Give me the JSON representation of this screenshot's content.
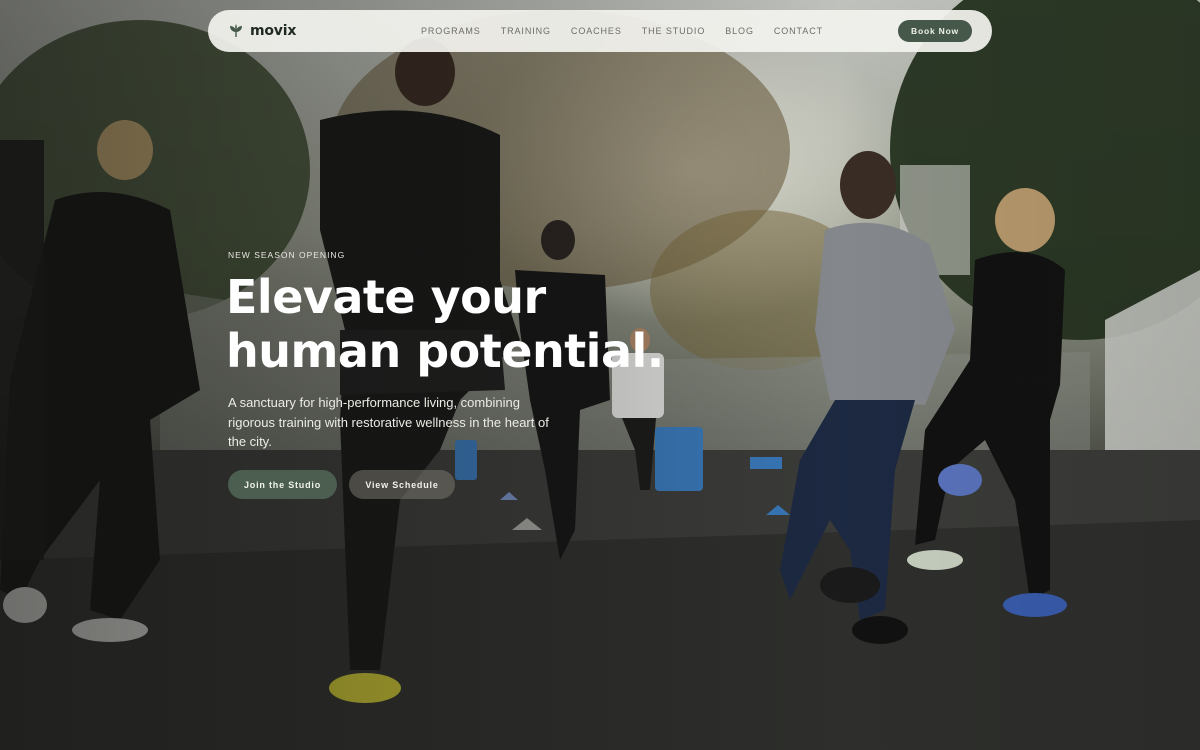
{
  "brand": {
    "name": "movix",
    "icon": "leaf-icon",
    "accent": "#46584a"
  },
  "nav": {
    "links": [
      "PROGRAMS",
      "TRAINING",
      "COACHES",
      "THE STUDIO",
      "BLOG",
      "CONTACT"
    ],
    "cta_label": "Book Now"
  },
  "hero": {
    "eyebrow": "NEW SEASON OPENING",
    "headline_line1": "Elevate your",
    "headline_line2": "human potential.",
    "subtitle": "A sanctuary for high-performance living, combining rigorous training with restorative wellness in the heart of the city.",
    "primary_cta": "Join the Studio",
    "secondary_cta": "View Schedule",
    "background_image": "outdoor-group-running-photo"
  }
}
